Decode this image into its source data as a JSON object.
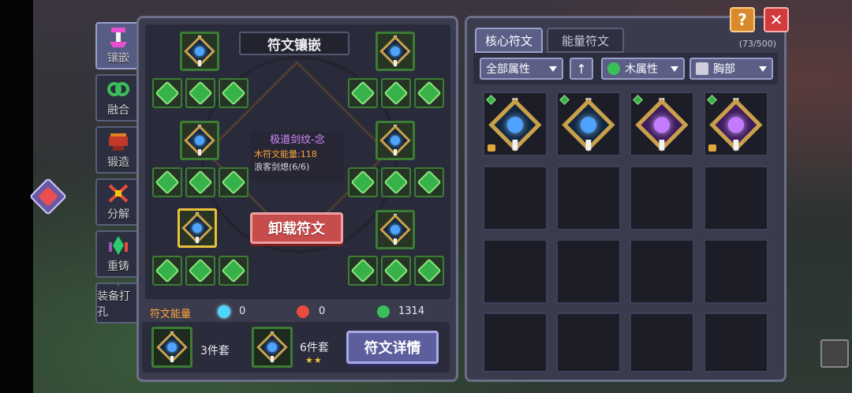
{
  "side_tabs": [
    {
      "label": "镶嵌",
      "icon": "inlay-icon",
      "active": true
    },
    {
      "label": "融合",
      "icon": "fusion-icon",
      "active": false
    },
    {
      "label": "锻造",
      "icon": "forge-icon",
      "active": false
    },
    {
      "label": "分解",
      "icon": "decompose-icon",
      "active": false
    },
    {
      "label": "重铸",
      "icon": "recast-icon",
      "active": false
    },
    {
      "label": "装备打孔",
      "icon": "socket-icon",
      "active": false
    }
  ],
  "rune_panel": {
    "title": "符文镶嵌",
    "tooltip": {
      "name": "极道剑纹-念",
      "energy": "木符文能量:118",
      "set": "浪客剑熄(6/6)"
    },
    "unload_label": "卸载符文",
    "energy_label": "符文能量",
    "energy_values": [
      "0",
      "0",
      "1314"
    ],
    "set3_label": "3件套",
    "set6_label": "6件套",
    "set6_stars": "★★",
    "detail_label": "符文详情"
  },
  "inventory": {
    "tabs": [
      "核心符文",
      "能量符文"
    ],
    "count": "(73/500)",
    "filters": {
      "all_attr": "全部属性",
      "sort_icon": "↑",
      "element": "木属性",
      "slot": "胸部"
    }
  },
  "buttons": {
    "help": "?",
    "close": "✕"
  }
}
